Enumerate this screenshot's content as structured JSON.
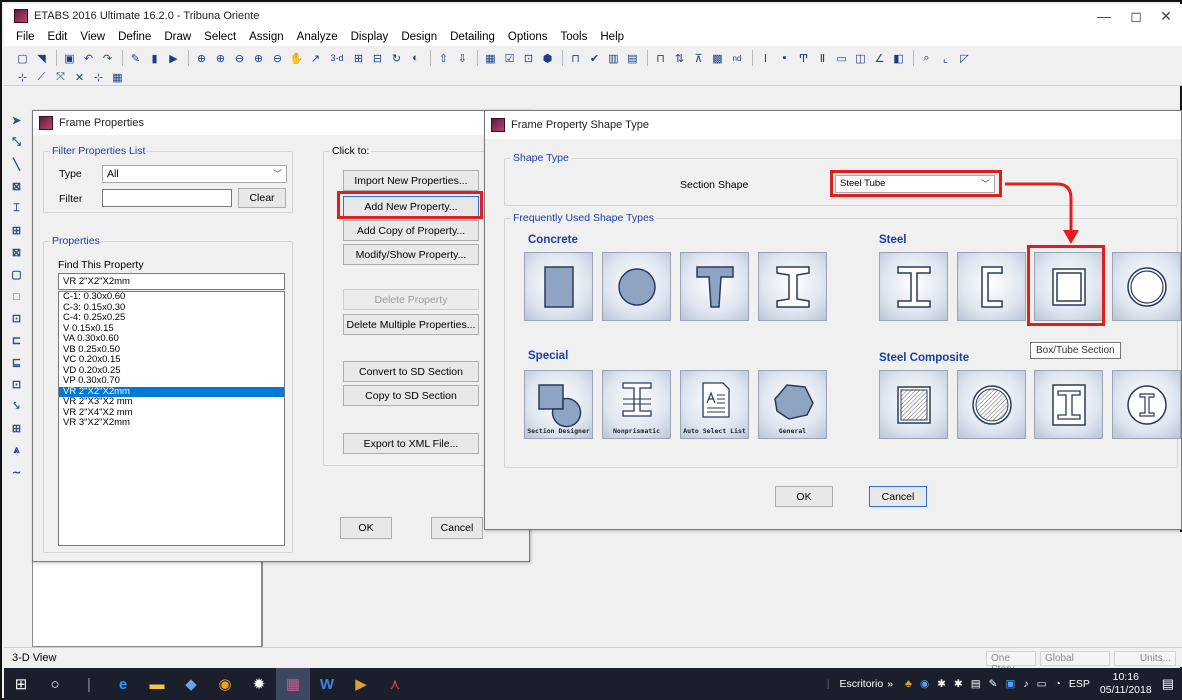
{
  "window": {
    "title": "ETABS 2016 Ultimate 16.2.0 - Tribuna Oriente",
    "minimize": "—",
    "maximize": "◻",
    "close": "✕"
  },
  "menu": [
    "File",
    "Edit",
    "View",
    "Define",
    "Draw",
    "Select",
    "Assign",
    "Analyze",
    "Display",
    "Design",
    "Detailing",
    "Options",
    "Tools",
    "Help"
  ],
  "toolbar": {
    "view_3d": "3-d",
    "plan": "nd"
  },
  "frame_properties": {
    "title": "Frame Properties",
    "filter_group": "Filter Properties List",
    "type_label": "Type",
    "type_value": "All",
    "filter_label": "Filter",
    "filter_value": "",
    "clear": "Clear",
    "properties_group": "Properties",
    "find_label": "Find This Property",
    "find_value": "VR 2\"X2\"X2mm",
    "items": [
      "C-1: 0.30x0.60",
      "C-3: 0.15x0.30",
      "C-4: 0.25x0.25",
      "V 0.15x0.15",
      "VA 0.30x0.60",
      "VB 0.25x0.50",
      "VC 0.20x0.15",
      "VD 0.20x0.25",
      "VP 0.30x0.70",
      "VR 2\"X2\"X2mm",
      "VR 2\"X3\"X2 mm",
      "VR 2\"X4\"X2 mm",
      "VR 3\"X2\"X2mm"
    ],
    "selected_index": 9,
    "click_to": "Click to:",
    "buttons": {
      "import": "Import New Properties...",
      "add_new": "Add New Property...",
      "add_copy": "Add Copy of Property...",
      "modify": "Modify/Show Property...",
      "delete": "Delete Property",
      "delete_multi": "Delete Multiple Properties...",
      "convert_sd": "Convert to SD Section",
      "copy_sd": "Copy to SD Section",
      "export_xml": "Export to XML File...",
      "ok": "OK",
      "cancel": "Cancel"
    }
  },
  "shape_type": {
    "title": "Frame Property Shape Type",
    "shape_type_group": "Shape Type",
    "section_shape_label": "Section Shape",
    "section_shape_value": "Steel Tube",
    "frequent_group": "Frequently Used Shape Types",
    "categories": {
      "concrete": "Concrete",
      "steel": "Steel",
      "special": "Special",
      "steel_composite": "Steel Composite"
    },
    "special_captions": [
      "Section Designer",
      "Nonprismatic",
      "Auto Select List",
      "General"
    ],
    "tooltip": "Box/Tube Section",
    "ok": "OK",
    "cancel": "Cancel"
  },
  "status": {
    "view": "3-D View",
    "story": "One Story",
    "coord": "Global",
    "units": "Units..."
  },
  "taskbar": {
    "desktop": "Escritorio",
    "lang": "ESP",
    "time": "10:16",
    "date": "05/11/2018"
  },
  "colors": {
    "highlight": "#e31d1d",
    "selection": "#0078d7",
    "group_label": "#1a3ea8",
    "arrow": "#e31d1d"
  }
}
